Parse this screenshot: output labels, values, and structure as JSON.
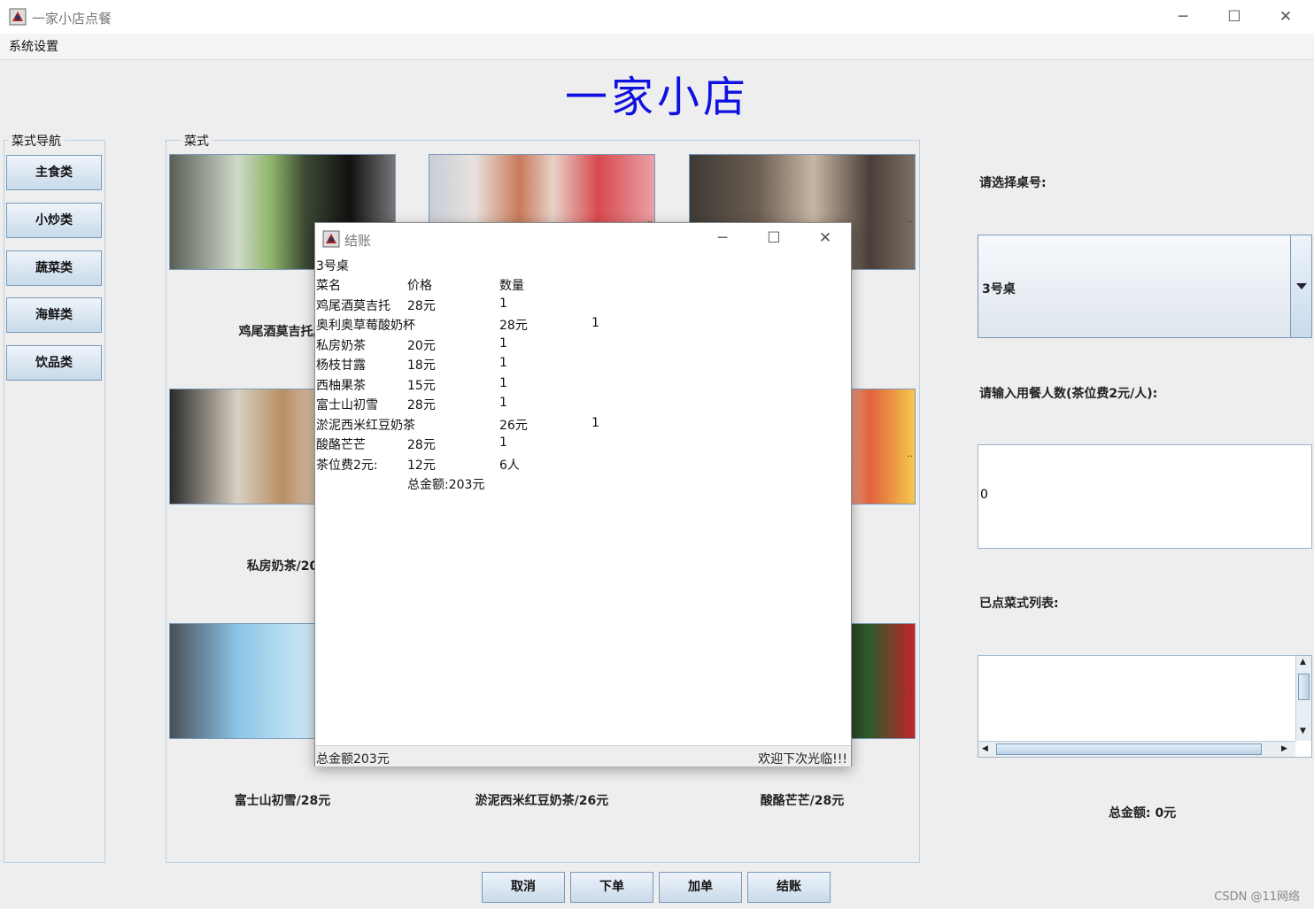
{
  "window": {
    "title": "一家小店点餐",
    "menu": "系统设置",
    "controls": [
      "─",
      "☐",
      "✕"
    ]
  },
  "heading": "一家小店",
  "nav": {
    "title": "菜式导航",
    "items": [
      "主食类",
      "小炒类",
      "蔬菜类",
      "海鲜类",
      "饮品类"
    ]
  },
  "dishes": {
    "title": "菜式",
    "labels": [
      "鸡尾酒莫吉托/2",
      "私房奶茶/20",
      "富士山初雪/28元",
      "淤泥西米红豆奶茶/26元",
      "酸酪芒芒/28元"
    ]
  },
  "right": {
    "table_label": "请选择桌号:",
    "table_value": "3号桌",
    "people_label": "请输入用餐人数(茶位费2元/人):",
    "people_value": "0",
    "ordered_label": "已点菜式列表:",
    "total": "总金额: 0元"
  },
  "buttons": [
    "取消",
    "下单",
    "加单",
    "结账"
  ],
  "watermark": "CSDN @11网络",
  "dialog": {
    "title": "结账",
    "table": "3号桌",
    "headers": [
      "菜名",
      "价格",
      "数量"
    ],
    "rows": [
      [
        "鸡尾酒莫吉托",
        "28元",
        "1"
      ],
      [
        "奥利奥草莓酸奶杯",
        "28元",
        "1"
      ],
      [
        "私房奶茶",
        "20元",
        "1"
      ],
      [
        "杨枝甘露",
        "18元",
        "1"
      ],
      [
        "西柚果茶",
        "15元",
        "1"
      ],
      [
        "富士山初雪",
        "28元",
        "1"
      ],
      [
        "淤泥西米红豆奶茶",
        "26元",
        "1"
      ],
      [
        "酸酪芒芒",
        "28元",
        "1"
      ],
      [
        "茶位费2元:",
        "12元",
        "6人"
      ]
    ],
    "total_line": "总金额:203元",
    "status_left": "总金额203元",
    "status_right": "欢迎下次光临!!!"
  }
}
